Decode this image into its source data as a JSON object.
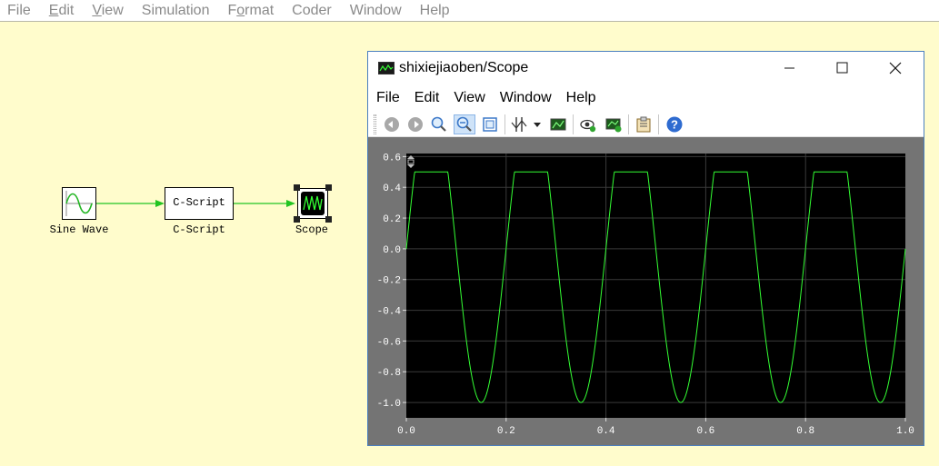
{
  "main_menu": [
    {
      "text": "File",
      "underline_index": -1
    },
    {
      "text": "Edit",
      "underline_index": 0
    },
    {
      "text": "View",
      "underline_index": 0
    },
    {
      "text": "Simulation",
      "underline_index": -1
    },
    {
      "text": "Format",
      "underline_index": 1
    },
    {
      "text": "Coder",
      "underline_index": -1
    },
    {
      "text": "Window",
      "underline_index": -1
    },
    {
      "text": "Help",
      "underline_index": -1
    }
  ],
  "blocks": {
    "sine": {
      "label": "Sine Wave"
    },
    "cscript": {
      "label": "C-Script",
      "inner_text": "C-Script"
    },
    "scope": {
      "label": "Scope"
    }
  },
  "scope_window": {
    "title": "shixiejiaoben/Scope",
    "menu": [
      "File",
      "Edit",
      "View",
      "Window",
      "Help"
    ],
    "toolbar_icons": [
      "back-icon",
      "forward-icon",
      "zoom-icon",
      "zoom-out-icon",
      "zoom-fit-icon",
      "cursor-icon",
      "dropdown-arrow-icon",
      "export-image-icon",
      "view-icon",
      "add-trace-icon",
      "properties-icon",
      "help-icon"
    ]
  },
  "colors": {
    "canvas": "#fffccc",
    "signal": "#22c422",
    "trace": "#33ff33",
    "plot_bg": "#000000"
  },
  "chart_data": {
    "type": "line",
    "title": "",
    "xlabel": "",
    "ylabel": "",
    "xlim": [
      0,
      1.0
    ],
    "ylim": [
      -1.1,
      0.62
    ],
    "xticks": [
      "0.0",
      "0.2",
      "0.4",
      "0.6",
      "0.8",
      "1.0"
    ],
    "yticks": [
      "0.6",
      "0.4",
      "0.2",
      "0.0",
      "-0.2",
      "-0.4",
      "-0.6",
      "-0.8",
      "-1.0"
    ],
    "grid": true,
    "series": [
      {
        "description_source": "sine wave, 5 Hz, clipped at 0.5",
        "frequency": 5,
        "amplitude": 1.0,
        "upper_limit": 0.5,
        "lower_limit": -1.0
      }
    ]
  }
}
